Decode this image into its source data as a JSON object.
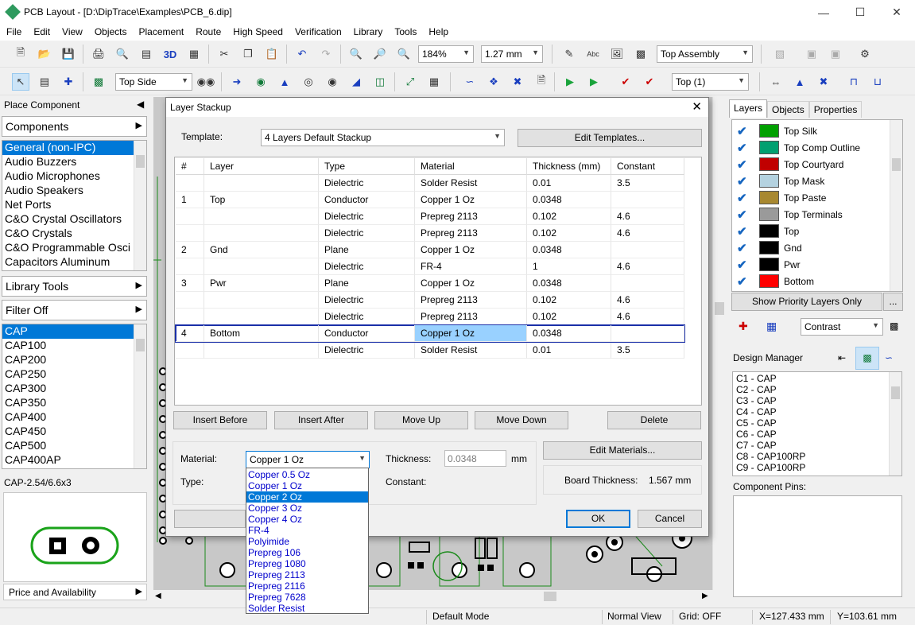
{
  "window": {
    "title": "PCB Layout - [D:\\DipTrace\\Examples\\PCB_6.dip]"
  },
  "menu": [
    "File",
    "Edit",
    "View",
    "Objects",
    "Placement",
    "Route",
    "High Speed",
    "Verification",
    "Library",
    "Tools",
    "Help"
  ],
  "toolbar1": {
    "zoom": "184%",
    "grid": "1.27 mm",
    "assembly": "Top Assembly",
    "label_3d": "3D"
  },
  "toolbar2": {
    "side": "Top Side",
    "layer": "Top (1)"
  },
  "left_panel": {
    "title": "Place Component",
    "components_header": "Components",
    "libraries": [
      "General (non-IPC)",
      "Audio Buzzers",
      "Audio Microphones",
      "Audio Speakers",
      "Net Ports",
      "C&O Crystal Oscillators",
      "C&O Crystals",
      "C&O Programmable Osci",
      "Capacitors Aluminum"
    ],
    "library_tools": "Library Tools",
    "filter": "Filter Off",
    "parts": [
      "CAP",
      "CAP100",
      "CAP200",
      "CAP250",
      "CAP300",
      "CAP350",
      "CAP400",
      "CAP450",
      "CAP500",
      "CAP400AP"
    ],
    "pattern_name": "CAP-2.54/6.6x3",
    "price_availability": "Price and Availability"
  },
  "dialog": {
    "title": "Layer Stackup",
    "template_label": "Template:",
    "template_value": "4 Layers Default Stackup",
    "edit_templates": "Edit Templates...",
    "columns": [
      "#",
      "Layer",
      "Type",
      "Material",
      "Thickness (mm)",
      "Constant"
    ],
    "rows": [
      {
        "num": "",
        "layer": "",
        "type": "Dielectric",
        "material": "Solder Resist",
        "thickness": "0.01",
        "constant": "3.5"
      },
      {
        "num": "1",
        "layer": "Top",
        "type": "Conductor",
        "material": "Copper 1 Oz",
        "thickness": "0.0348",
        "constant": ""
      },
      {
        "num": "",
        "layer": "",
        "type": "Dielectric",
        "material": "Prepreg 2113",
        "thickness": "0.102",
        "constant": "4.6"
      },
      {
        "num": "",
        "layer": "",
        "type": "Dielectric",
        "material": "Prepreg 2113",
        "thickness": "0.102",
        "constant": "4.6"
      },
      {
        "num": "2",
        "layer": "Gnd",
        "type": "Plane",
        "material": "Copper 1 Oz",
        "thickness": "0.0348",
        "constant": ""
      },
      {
        "num": "",
        "layer": "",
        "type": "Dielectric",
        "material": "FR-4",
        "thickness": "1",
        "constant": "4.6"
      },
      {
        "num": "3",
        "layer": "Pwr",
        "type": "Plane",
        "material": "Copper 1 Oz",
        "thickness": "0.0348",
        "constant": ""
      },
      {
        "num": "",
        "layer": "",
        "type": "Dielectric",
        "material": "Prepreg 2113",
        "thickness": "0.102",
        "constant": "4.6"
      },
      {
        "num": "",
        "layer": "",
        "type": "Dielectric",
        "material": "Prepreg 2113",
        "thickness": "0.102",
        "constant": "4.6"
      },
      {
        "num": "4",
        "layer": "Bottom",
        "type": "Conductor",
        "material": "Copper 1 Oz",
        "thickness": "0.0348",
        "constant": ""
      },
      {
        "num": "",
        "layer": "",
        "type": "Dielectric",
        "material": "Solder Resist",
        "thickness": "0.01",
        "constant": "3.5"
      }
    ],
    "selected_row": 9,
    "buttons": {
      "insert_before": "Insert Before",
      "insert_after": "Insert After",
      "move_up": "Move Up",
      "move_down": "Move Down",
      "delete": "Delete",
      "edit_materials": "Edit Materials...",
      "ok": "OK",
      "cancel": "Cancel"
    },
    "material_label": "Material:",
    "material_value": "Copper 1 Oz",
    "type_label": "Type:",
    "thickness_label": "Thickness:",
    "thickness_value": "0.0348",
    "thickness_unit": "mm",
    "constant_label": "Constant:",
    "board_thickness_label": "Board Thickness:",
    "board_thickness_value": "1.567 mm",
    "dropdown_options": [
      "Copper 0.5 Oz",
      "Copper 1 Oz",
      "Copper 2 Oz",
      "Copper 3 Oz",
      "Copper 4 Oz",
      "FR-4",
      "Polyimide",
      "Prepreg 106",
      "Prepreg 1080",
      "Prepreg 2113",
      "Prepreg 2116",
      "Prepreg 7628",
      "Solder Resist"
    ],
    "dropdown_selected": 2
  },
  "right_panel": {
    "tabs": [
      "Layers",
      "Objects",
      "Properties"
    ],
    "layers": [
      {
        "name": "Top Silk",
        "color": "#00a000"
      },
      {
        "name": "Top Comp Outline",
        "color": "#00a070"
      },
      {
        "name": "Top Courtyard",
        "color": "#c00000"
      },
      {
        "name": "Top Mask",
        "color": "#b4d2e0"
      },
      {
        "name": "Top Paste",
        "color": "#a88830"
      },
      {
        "name": "Top Terminals",
        "color": "#9a9a9a"
      },
      {
        "name": "Top",
        "color": "#000000"
      },
      {
        "name": "Gnd",
        "color": "#000000"
      },
      {
        "name": "Pwr",
        "color": "#000000"
      },
      {
        "name": "Bottom",
        "color": "#ff0000"
      }
    ],
    "show_priority": "Show Priority Layers Only",
    "more": "...",
    "contrast": "Contrast",
    "design_manager_title": "Design Manager",
    "design_items": [
      "C1 - CAP",
      "C2 - CAP",
      "C3 - CAP",
      "C4 - CAP",
      "C5 - CAP",
      "C6 - CAP",
      "C7 - CAP",
      "C8 - CAP100RP",
      "C9 - CAP100RP"
    ],
    "component_pins": "Component Pins:"
  },
  "status": {
    "mode": "Default Mode",
    "view": "Normal View",
    "grid": "Grid: OFF",
    "x": "X=127.433 mm",
    "y": "Y=103.61 mm"
  }
}
